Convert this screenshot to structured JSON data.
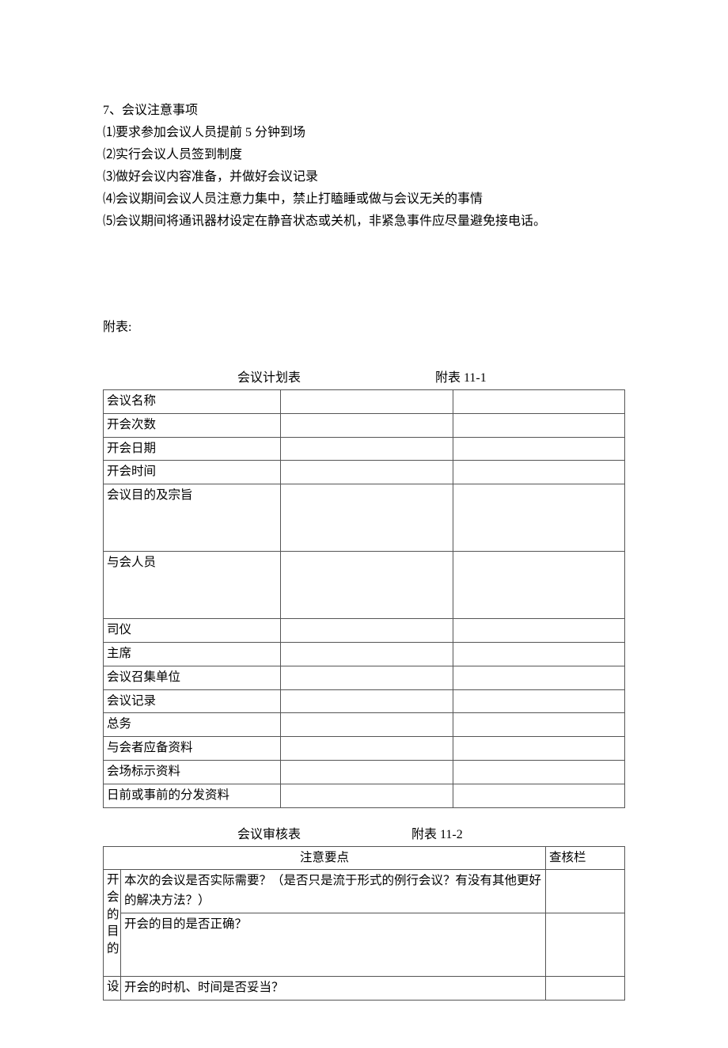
{
  "section": {
    "num_title": "7、会议注意事项",
    "items": [
      "⑴要求参加会议人员提前 5 分钟到场",
      "⑵实行会议人员签到制度",
      "⑶做好会议内容准备，并做好会议记录",
      "⑷会议期间会议人员注意力集中，禁止打瞌睡或做与会议无关的事情",
      "⑸会议期间将通讯器材设定在静音状态或关机，非紧急事件应尽量避免接电话。"
    ]
  },
  "appendix_label": "附表:",
  "table1": {
    "title": "会议计划表",
    "appendix": "附表 11-1",
    "rows": [
      "会议名称",
      "开会次数",
      "开会日期",
      "开会时间",
      "会议目的及宗旨",
      "与会人员",
      "司仪",
      "主席",
      "会议召集单位",
      "会议记录",
      "总务",
      "与会者应备资料",
      "会场标示资料",
      "日前或事前的分发资料"
    ]
  },
  "table2": {
    "title": "会议审核表",
    "appendix": "附表 11-2",
    "header": {
      "c1": "注意要点",
      "c2": "查核栏"
    },
    "group1": {
      "chars": [
        "开",
        "会",
        "的",
        "目",
        "的"
      ],
      "r1": "本次的会议是否实际需要？（是否只是流于形式的例行会议？有没有其他更好的解决方法？）",
      "r2": "开会的目的是否正确？"
    },
    "group2": {
      "chars": [
        "设"
      ],
      "r1": "开会的时机、时间是否妥当？"
    }
  }
}
